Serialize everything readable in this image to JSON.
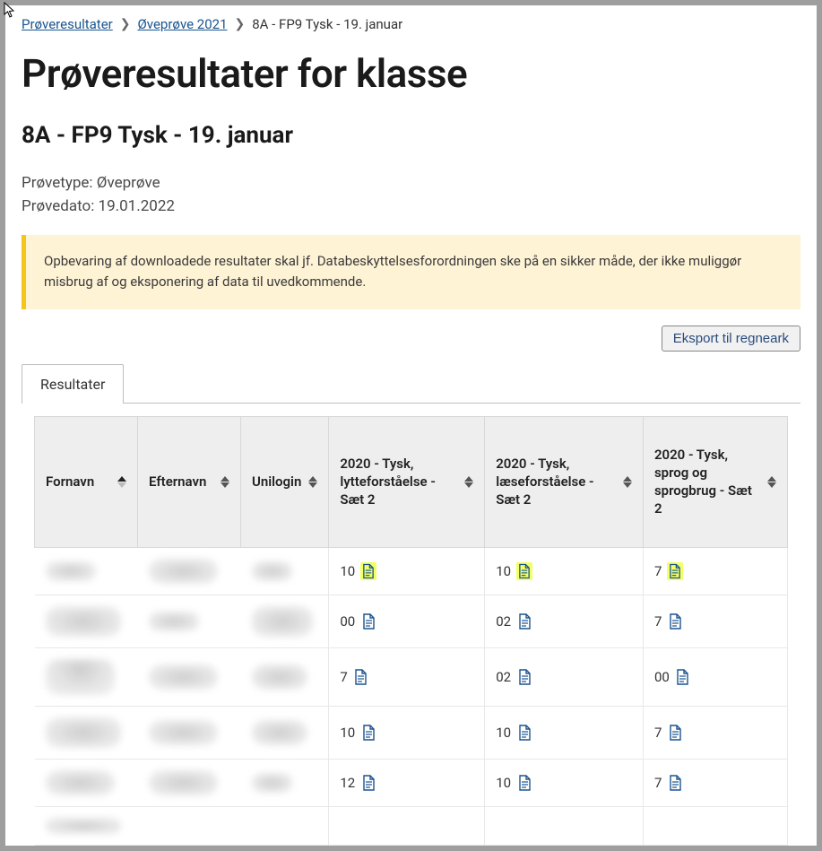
{
  "breadcrumb": {
    "link1": "Prøveresultater",
    "link2": "Øveprøve 2021",
    "current": "8A - FP9 Tysk - 19. januar"
  },
  "header": {
    "title": "Prøveresultater for klasse",
    "subtitle": "8A - FP9 Tysk - 19. januar"
  },
  "meta": {
    "type_label": "Prøvetype:",
    "type_value": "Øveprøve",
    "date_label": "Prøvedato:",
    "date_value": "19.01.2022"
  },
  "alert": {
    "text": "Opbevaring af downloadede resultater skal jf. Databeskyttelsesforordningen ske på en sikker måde, der ikke muliggør misbrug af og eksponering af data til uvedkommende."
  },
  "actions": {
    "export": "Eksport til regneark"
  },
  "tabs": {
    "results": "Resultater"
  },
  "table": {
    "headers": {
      "fornavn": "Fornavn",
      "efternavn": "Efternavn",
      "unilogin": "Unilogin",
      "col1": "2020 - Tysk, lytteforståelse - Sæt 2",
      "col2": "2020 - Tysk, læseforståelse - Sæt 2",
      "col3": "2020 - Tysk, sprog og sprogbrug - Sæt 2"
    },
    "rows": [
      {
        "s1": "10",
        "s2": "10",
        "s3": "7",
        "hl": true
      },
      {
        "s1": "00",
        "s2": "02",
        "s3": "7",
        "hl": false
      },
      {
        "s1": "7",
        "s2": "02",
        "s3": "00",
        "hl": false
      },
      {
        "s1": "10",
        "s2": "10",
        "s3": "7",
        "hl": false
      },
      {
        "s1": "12",
        "s2": "10",
        "s3": "7",
        "hl": false
      }
    ]
  }
}
